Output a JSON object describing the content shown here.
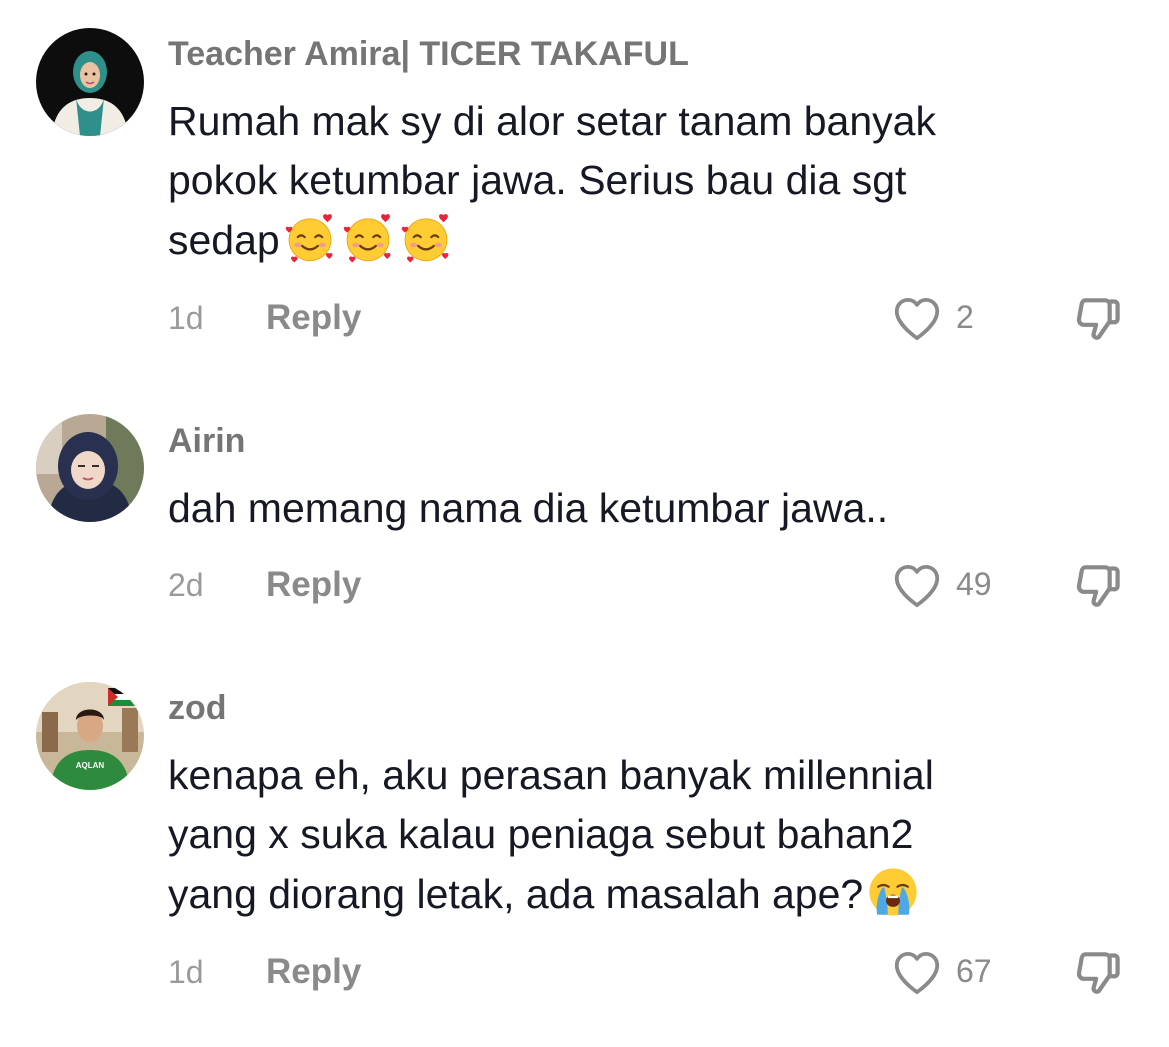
{
  "comments": [
    {
      "username": "Teacher Amira| TICER TAKAFUL",
      "lines": [
        "Rumah mak sy di alor setar tanam banyak",
        "pokok ketumbar jawa. Serius bau dia sgt",
        "sedap"
      ],
      "emoji": [
        "smiling-face-with-hearts",
        "smiling-face-with-hearts",
        "smiling-face-with-hearts"
      ],
      "time": "1d",
      "reply_label": "Reply",
      "likes": "2"
    },
    {
      "username": "Airin",
      "lines": [
        "dah memang nama dia ketumbar jawa.."
      ],
      "time": "2d",
      "reply_label": "Reply",
      "likes": "49"
    },
    {
      "username": "zod",
      "lines": [
        "kenapa eh, aku perasan banyak millennial",
        "yang x suka kalau peniaga sebut bahan2",
        "yang diorang letak, ada masalah ape?"
      ],
      "emoji": [
        "loudly-crying-face"
      ],
      "avatar_text": "AQLAN",
      "time": "1d",
      "reply_label": "Reply",
      "likes": "67"
    }
  ],
  "colors": {
    "text": "#161823",
    "username": "#757575",
    "secondary": "#8a8a8a"
  }
}
